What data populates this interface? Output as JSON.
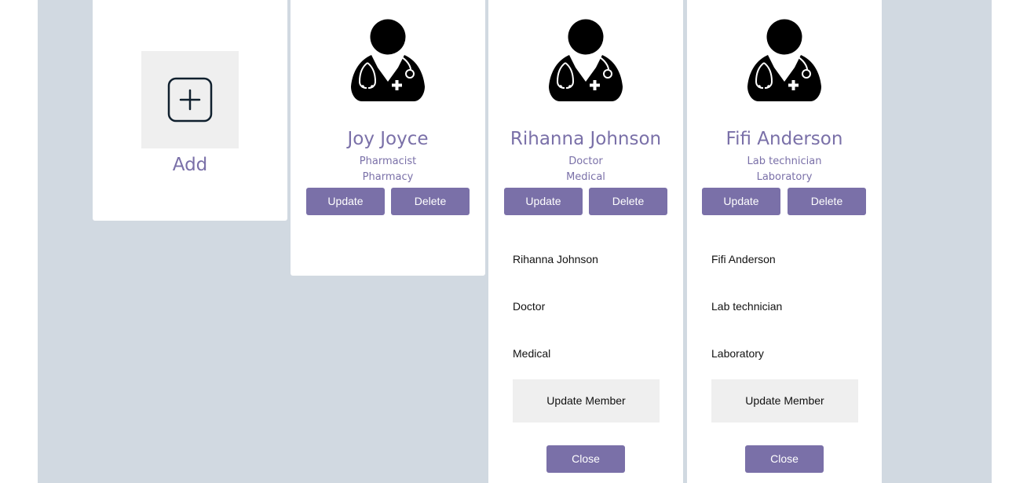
{
  "add_card": {
    "label": "Add",
    "icon": "plus-square-icon"
  },
  "members": [
    {
      "name": "Joy Joyce",
      "role": "Pharmacist",
      "department": "Pharmacy",
      "update_label": "Update",
      "delete_label": "Delete",
      "avatar_icon": "doctor-avatar-icon"
    },
    {
      "name": "Rihanna Johnson",
      "role": "Doctor",
      "department": "Medical",
      "update_label": "Update",
      "delete_label": "Delete",
      "avatar_icon": "doctor-avatar-icon",
      "edit_form": {
        "name_value": "Rihanna Johnson",
        "role_value": "Doctor",
        "department_value": "Medical",
        "submit_label": "Update Member",
        "close_label": "Close"
      }
    },
    {
      "name": "Fifi Anderson",
      "role": "Lab technician",
      "department": "Laboratory",
      "update_label": "Update",
      "delete_label": "Delete",
      "avatar_icon": "doctor-avatar-icon",
      "edit_form": {
        "name_value": "Fifi Anderson",
        "role_value": "Lab technician",
        "department_value": "Laboratory",
        "submit_label": "Update Member",
        "close_label": "Close"
      }
    }
  ],
  "colors": {
    "accent": "#7a70a8",
    "board_background": "#d1d9e1",
    "card_background": "#ffffff",
    "tile_background": "#efefef"
  }
}
